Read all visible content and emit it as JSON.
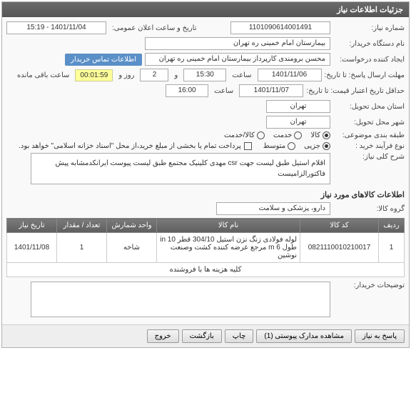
{
  "panel": {
    "title": "جزئیات اطلاعات نیاز"
  },
  "fields": {
    "need_no_label": "شماره نیاز:",
    "need_no": "1101090614001491",
    "announce_label": "تاریخ و ساعت اعلان عمومی:",
    "announce": "1401/11/04 - 15:19",
    "buyer_label": "نام دستگاه خریدار:",
    "buyer": "بیمارستان امام خمینی ره  تهران",
    "creator_label": "ایجاد کننده درخواست:",
    "creator": "محسن برومندی کارپرداز بیمارستان امام خمینی ره  تهران",
    "contact_badge": "اطلاعات تماس خریدار",
    "deadline_label": "مهلت ارسال پاسخ: تا تاریخ:",
    "deadline_date": "1401/11/06",
    "time_label": "ساعت",
    "deadline_time": "15:30",
    "and_label": "و",
    "days": "2",
    "days_label": "روز و",
    "countdown": "00:01:59",
    "remaining_label": "ساعت باقی مانده",
    "validity_label": "حداقل تاریخ اعتبار قیمت: تا تاریخ:",
    "validity_date": "1401/11/07",
    "validity_time": "16:00",
    "province_label": "استان محل تحویل:",
    "province": "تهران",
    "city_label": "شهر محل تحویل:",
    "city": "تهران",
    "category_label": "طبقه بندی موضوعی:",
    "cat_goods": "کالا",
    "cat_service": "خدمت",
    "cat_goods_service": "کالا/خدمت",
    "process_label": "نوع فرآیند خرید :",
    "proc_minor": "جزیی",
    "proc_medium": "متوسط",
    "proc_note": "پرداخت تمام یا بخشی از مبلغ خرید،از محل \"اسناد خزانه اسلامی\" خواهد بود.",
    "desc_label": "شرح کلی نیاز:",
    "desc": "اقلام استیل طبق لیست جهت csr مهدی کلینیک مجتمع طبق لیست پیوست ایرانکدمشابه پیش فاکتورالزامیست"
  },
  "goods_section": {
    "title": "اطلاعات کالاهای مورد نیاز",
    "group_label": "گروه کالا:",
    "group": "دارو، پزشکی و سلامت"
  },
  "table": {
    "headers": {
      "row": "ردیف",
      "code": "کد کالا",
      "name": "نام کالا",
      "unit": "واحد شمارش",
      "qty": "تعداد / مقدار",
      "date": "تاریخ نیاز"
    },
    "rows": [
      {
        "row": "1",
        "code": "0821110010210017",
        "name": "لوله فولادی زنگ نزن استیل 304/10 قطر in 10 طول m 6 مرجع عرضه کننده کشت وصنعت نوشین",
        "unit": "شاخه",
        "qty": "1",
        "date": "1401/11/08"
      }
    ],
    "footer": "کلیه هزینه ها با فروشنده"
  },
  "comments": {
    "label": "توضیحات خریدار:"
  },
  "buttons": {
    "back": "پاسخ به نیاز",
    "attachments": "مشاهده مدارک پیوستی (1)",
    "print": "چاپ",
    "exit": "بازگشت",
    "close": "خروج"
  }
}
